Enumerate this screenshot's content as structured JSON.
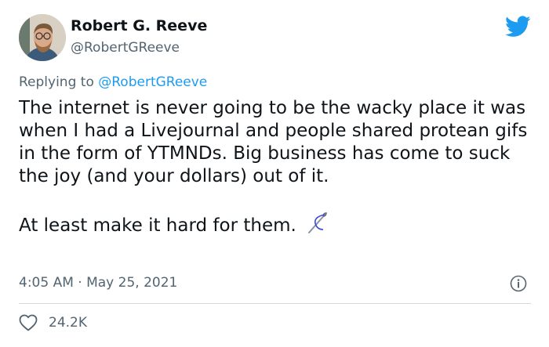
{
  "tweet": {
    "author": {
      "display_name": "Robert G. Reeve",
      "handle": "@RobertGReeve"
    },
    "reply": {
      "prefix": "Replying to",
      "handle": "@RobertGReeve"
    },
    "text": {
      "paragraph_1": "The internet is never going to be the wacky place it was when I had a Livejournal and people shared protean gifs in the form of YTMNDs. Big business has come to suck the joy (and your dollars) out of it.",
      "paragraph_2": "At least make it hard for them."
    },
    "emoji": "sewing-needle",
    "timestamp": "4:05 AM · May 25, 2021",
    "like_count": "24.2K",
    "brand_color": "#1d9bf0"
  }
}
